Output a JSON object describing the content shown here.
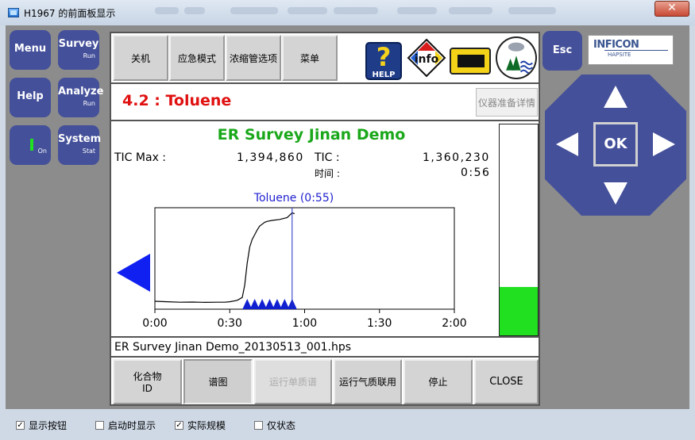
{
  "window": {
    "title": "H1967 的前面板显示",
    "close_glyph": "✕"
  },
  "left_buttons": {
    "menu": {
      "label": "Menu"
    },
    "survey": {
      "label": "Survey",
      "sub": "Run"
    },
    "help": {
      "label": "Help"
    },
    "analyze": {
      "label": "Analyze",
      "sub": "Run"
    },
    "power": {
      "sub": "On",
      "indicator_color": "#20e020"
    },
    "system": {
      "label": "System",
      "sub": "Stat"
    }
  },
  "top_toolbar": {
    "off": "关机",
    "emergency": "应急模式",
    "tube_options": "浓缩管选项",
    "menu": "菜单"
  },
  "icons": {
    "help": {
      "name": "help-icon",
      "text": "HELP",
      "glyph": "?"
    },
    "info": {
      "name": "info-icon",
      "text": "info"
    },
    "device": {
      "name": "device-icon"
    },
    "environment": {
      "name": "environment-icon"
    }
  },
  "compound_title": "4.2 : Toluene",
  "detail_button": "仪器准备详情",
  "survey": {
    "name": "ER Survey Jinan Demo",
    "tic_max_label": "TIC Max :",
    "tic_max_value": "1,394,860",
    "tic_label": "TIC :",
    "tic_value": "1,360,230",
    "time_label": "时间 :",
    "time_value": "0:56",
    "file": "ER Survey Jinan Demo_20130513_001.hps"
  },
  "chart_data": {
    "type": "line",
    "title": "",
    "xlabel": "",
    "ylabel": "",
    "xticks": [
      "0:00",
      "0:30",
      "1:00",
      "1:30",
      "2:00"
    ],
    "x_unit": "seconds",
    "xlim": [
      0,
      120
    ],
    "ylim": [
      0,
      1
    ],
    "y_relative": true,
    "x": [
      0,
      5,
      10,
      15,
      20,
      25,
      28,
      30,
      33,
      35,
      36,
      37,
      38,
      39,
      40,
      41,
      42,
      43,
      44,
      45,
      47,
      50,
      53,
      55,
      56
    ],
    "y": [
      0.05,
      0.045,
      0.04,
      0.042,
      0.038,
      0.04,
      0.04,
      0.045,
      0.06,
      0.09,
      0.22,
      0.45,
      0.62,
      0.7,
      0.75,
      0.8,
      0.84,
      0.86,
      0.88,
      0.89,
      0.9,
      0.91,
      0.93,
      0.98,
      0.97
    ],
    "peak_label": "Toluene (0:55)",
    "peak_x": 55,
    "markers_x": [
      37,
      40,
      43,
      46,
      49,
      52,
      55
    ],
    "marker_color": "#1020d0",
    "line_color": "#000000",
    "cursor_color": "#2030c0",
    "level_fraction": 0.23,
    "level_color": "#20e020"
  },
  "bottom_toolbar": {
    "compound_id": "化合物\nID",
    "spectrum": "谱图",
    "run_single": "运行单质谱",
    "run_gcms": "运行气质联用",
    "stop": "停止",
    "close": "CLOSE"
  },
  "right_panel": {
    "esc": "Esc",
    "logo_main": "INFICON",
    "logo_sub": "HAPSITE",
    "ok": "OK"
  },
  "checkboxes": [
    {
      "label": "显示按钮",
      "checked": true
    },
    {
      "label": "启动时显示",
      "checked": false
    },
    {
      "label": "实际规模",
      "checked": true
    },
    {
      "label": "仅状态",
      "checked": false
    }
  ],
  "colors": {
    "button_blue": "#44509a",
    "title_red": "#e01010",
    "survey_green": "#1aa81a",
    "arrow_blue": "#1020f0"
  }
}
